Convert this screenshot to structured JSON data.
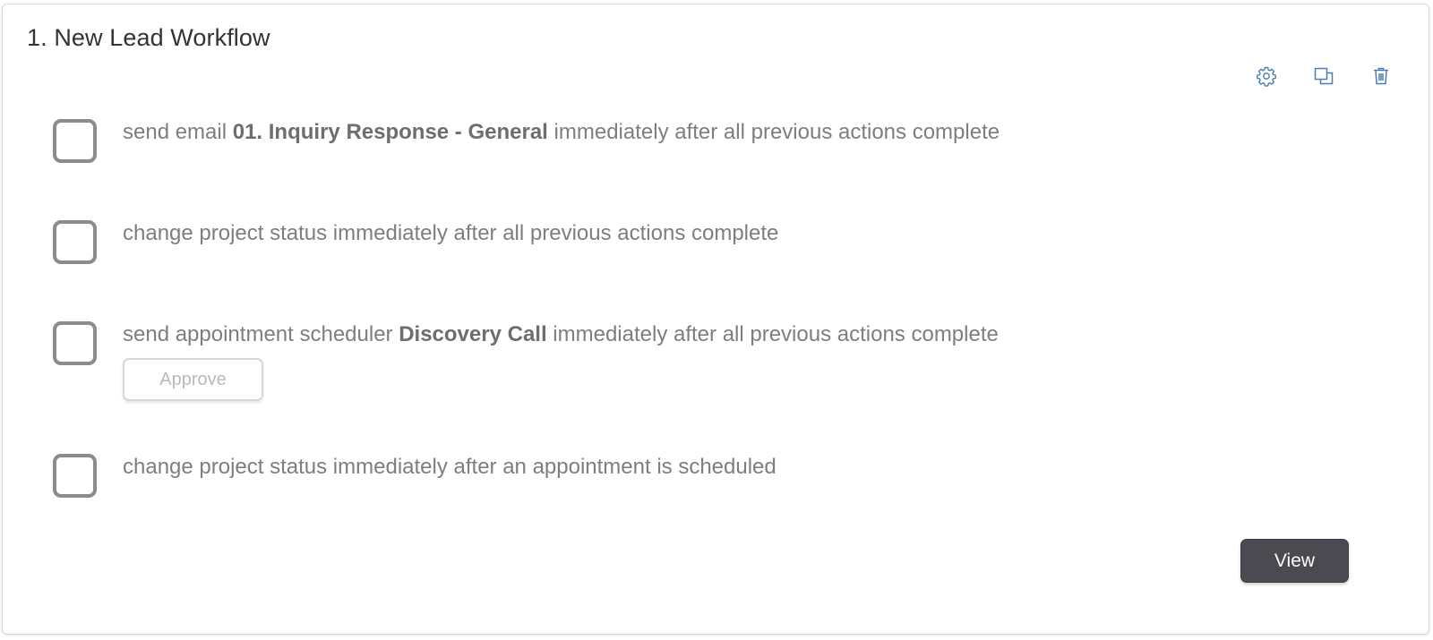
{
  "workflow": {
    "title": "1. New Lead Workflow",
    "toolbar": {
      "settings_icon": "gear-icon",
      "duplicate_icon": "copy-icon",
      "delete_icon": "trash-icon",
      "icon_color": "#4a7fb5"
    },
    "actions": [
      {
        "prefix": "send email ",
        "highlight": "01. Inquiry Response - General",
        "suffix": " immediately after all previous actions complete"
      },
      {
        "prefix": "change project status immediately after all previous actions complete",
        "highlight": "",
        "suffix": ""
      },
      {
        "prefix": "send appointment scheduler ",
        "highlight": "Discovery Call",
        "suffix": " immediately after all previous actions complete",
        "approve_label": "Approve"
      },
      {
        "prefix": "change project status immediately after an appointment is scheduled",
        "highlight": "",
        "suffix": ""
      }
    ],
    "view_label": "View"
  }
}
